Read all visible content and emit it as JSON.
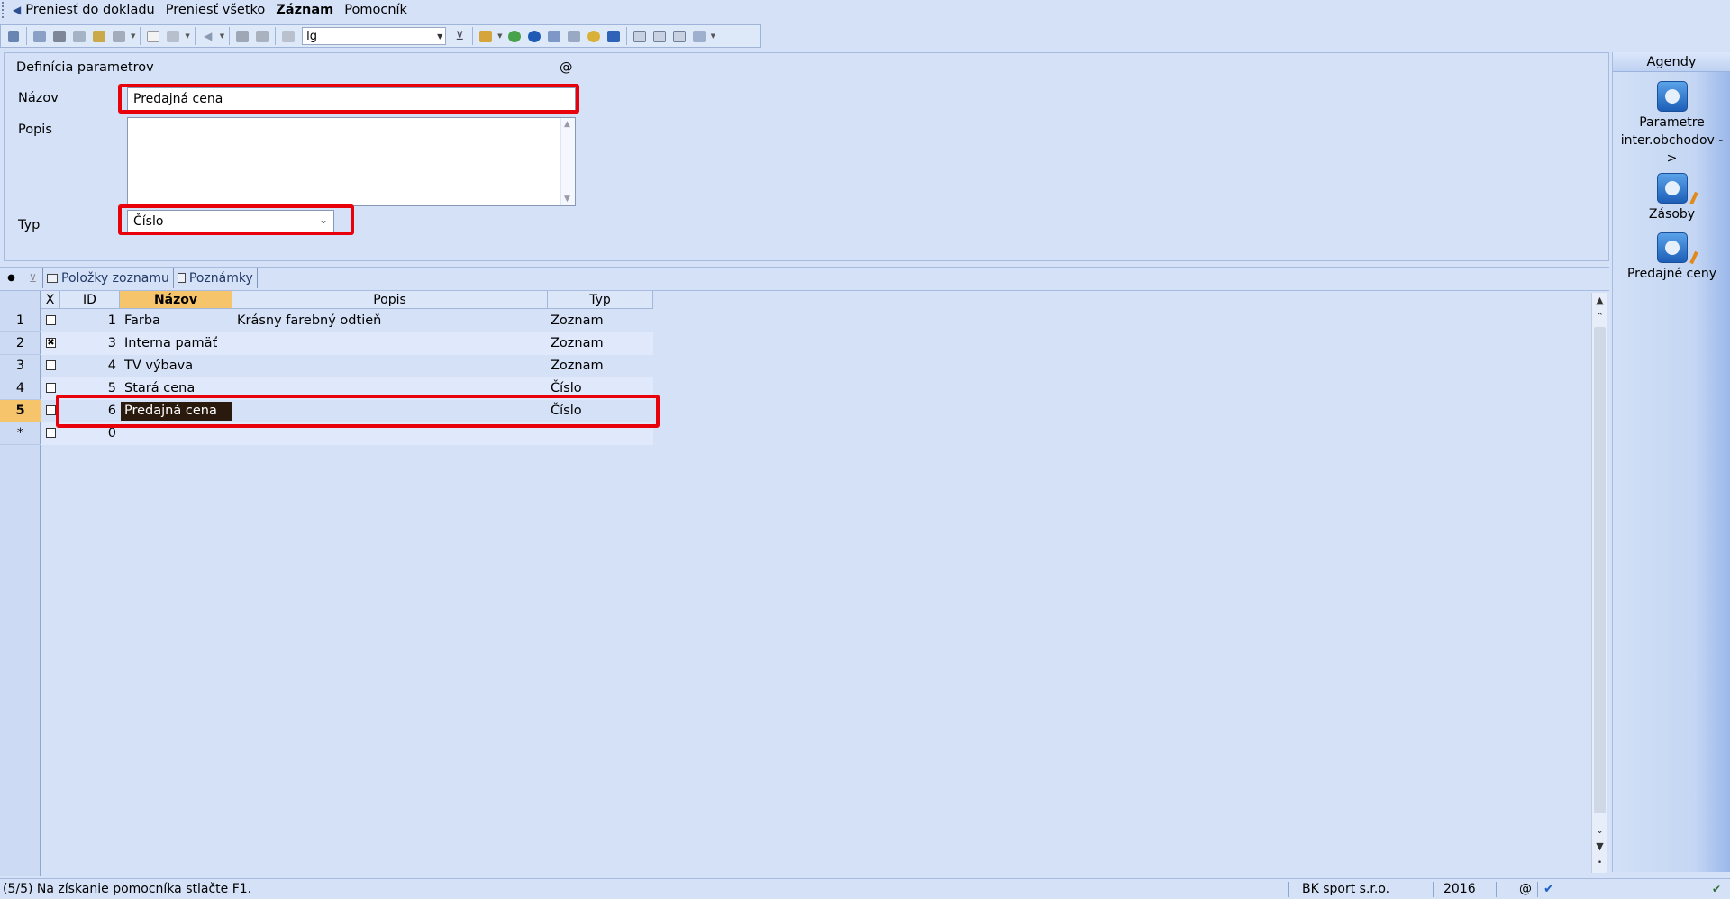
{
  "menu": {
    "items": [
      {
        "label": "Preniesť do dokladu",
        "bold": false
      },
      {
        "label": "Preniesť všetko",
        "bold": false
      },
      {
        "label": "Záznam",
        "bold": true
      },
      {
        "label": "Pomocník",
        "bold": false
      }
    ]
  },
  "toolbar": {
    "combo_value": "lg"
  },
  "form": {
    "title": "Definícia parametrov",
    "at_symbol": "@",
    "nazov_label": "Názov",
    "nazov_value": "Predajná cena",
    "popis_label": "Popis",
    "popis_value": "",
    "typ_label": "Typ",
    "typ_value": "Číslo"
  },
  "agendy": {
    "title": "Agendy",
    "items": [
      {
        "label": "Parametre inter.obchodov ->"
      },
      {
        "label": "Zásoby"
      },
      {
        "label": "Predajné ceny"
      }
    ]
  },
  "tabs": {
    "polozky": "Položky zoznamu",
    "poznamky": "Poznámky"
  },
  "grid": {
    "columns": {
      "x": "X",
      "id": "ID",
      "nazov": "Názov",
      "popis": "Popis",
      "typ": "Typ"
    },
    "rows": [
      {
        "num": "1",
        "checked": false,
        "id": "1",
        "nazov": "Farba",
        "popis": "Krásny farebný odtieň",
        "typ": "Zoznam"
      },
      {
        "num": "2",
        "checked": true,
        "id": "3",
        "nazov": "Interna pamäť",
        "popis": "",
        "typ": "Zoznam"
      },
      {
        "num": "3",
        "checked": false,
        "id": "4",
        "nazov": "TV výbava",
        "popis": "",
        "typ": "Zoznam"
      },
      {
        "num": "4",
        "checked": false,
        "id": "5",
        "nazov": "Stará cena",
        "popis": "",
        "typ": "Číslo"
      },
      {
        "num": "5",
        "checked": false,
        "id": "6",
        "nazov": "Predajná cena",
        "popis": "",
        "typ": "Číslo",
        "active": true
      },
      {
        "num": "*",
        "checked": false,
        "id": "0",
        "nazov": "",
        "popis": "",
        "typ": ""
      }
    ]
  },
  "status": {
    "message": "(5/5) Na získanie pomocníka stlačte F1.",
    "company": "BK sport  s.r.o.",
    "year": "2016",
    "at_symbol": "@"
  }
}
